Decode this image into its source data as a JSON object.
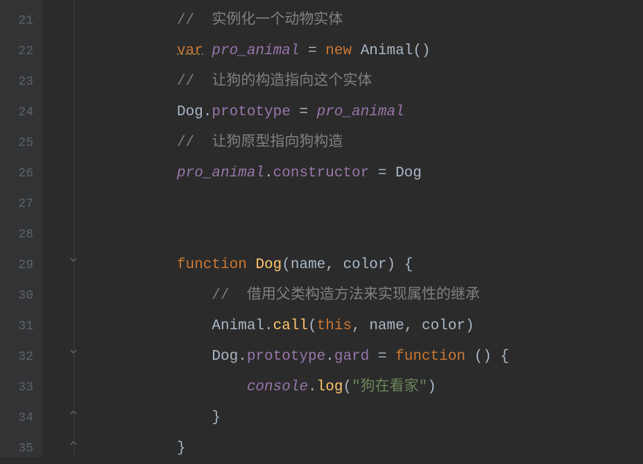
{
  "lineNumbers": [
    "21",
    "22",
    "23",
    "24",
    "25",
    "26",
    "27",
    "28",
    "29",
    "30",
    "31",
    "32",
    "33",
    "34",
    "35"
  ],
  "code": {
    "l21": {
      "comment": "//  实例化一个动物实体"
    },
    "l22": {
      "var": "var",
      "proAnimal": "pro_animal",
      "eq": " = ",
      "new": "new",
      "sp": " ",
      "animal": "Animal",
      "parens": "()"
    },
    "l23": {
      "comment": "//  让狗的构造指向这个实体"
    },
    "l24": {
      "dog": "Dog",
      "dot1": ".",
      "prototype": "prototype",
      "eq": " = ",
      "proAnimal": "pro_animal"
    },
    "l25": {
      "comment": "//  让狗原型指向狗构造"
    },
    "l26": {
      "proAnimal": "pro_animal",
      "dot": ".",
      "constructor": "constructor",
      "eq": " = ",
      "dog": "Dog"
    },
    "l29": {
      "function": "function",
      "sp": " ",
      "dogFn": "Dog",
      "lp": "(",
      "name": "name",
      "comma": ", ",
      "color": "color",
      "rp": ")",
      "sp2": " ",
      "lb": "{"
    },
    "l30": {
      "comment": "//  借用父类构造方法来实现属性的继承"
    },
    "l31": {
      "animal": "Animal",
      "dot": ".",
      "call": "call",
      "lp": "(",
      "this": "this",
      "c1": ", ",
      "name": "name",
      "c2": ", ",
      "color": "color",
      "rp": ")"
    },
    "l32": {
      "dog": "Dog",
      "d1": ".",
      "prototype": "prototype",
      "d2": ".",
      "gard": "gard",
      "eq": " = ",
      "function": "function",
      "sp": " ",
      "lp": "(",
      "rp": ")",
      "sp2": " ",
      "lb": "{"
    },
    "l33": {
      "console": "console",
      "dot": ".",
      "log": "log",
      "lp": "(",
      "str": "\"狗在看家\"",
      "rp": ")"
    },
    "l34": {
      "rb": "}"
    },
    "l35": {
      "rb": "}"
    }
  }
}
